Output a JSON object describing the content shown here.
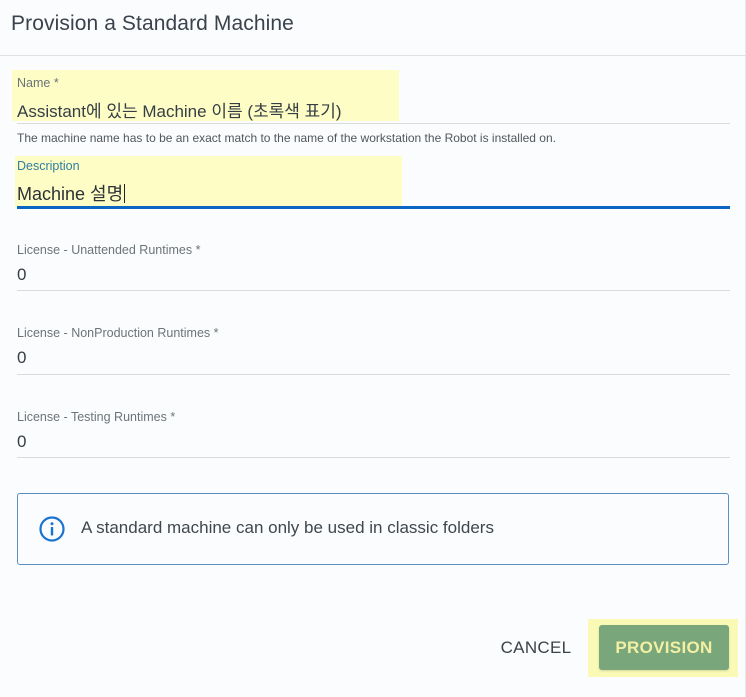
{
  "dialog": {
    "title": "Provision a Standard Machine"
  },
  "fields": {
    "name": {
      "label": "Name *",
      "value": "Assistant에 있는 Machine 이름 (초록색 표기)",
      "hint": "The machine name has to be an exact match to the name of the workstation the Robot is installed on."
    },
    "description": {
      "label": "Description",
      "value": "Machine 설명"
    },
    "unattended": {
      "label": "License - Unattended Runtimes *",
      "value": "0"
    },
    "nonproduction": {
      "label": "License - NonProduction Runtimes *",
      "value": "0"
    },
    "testing": {
      "label": "License - Testing Runtimes *",
      "value": "0"
    }
  },
  "info": {
    "icon": "info-icon",
    "text": "A standard machine can only be used in classic folders"
  },
  "actions": {
    "cancel_label": "CANCEL",
    "provision_label": "PROVISION"
  },
  "colors": {
    "accent": "#0a66c2",
    "highlight": "#fdfdc2",
    "provision_bg": "#79a77b",
    "info_border": "#5b8fc4"
  }
}
